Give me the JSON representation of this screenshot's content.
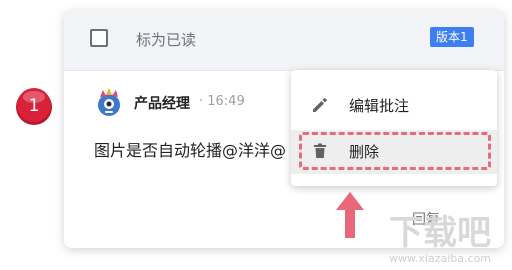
{
  "header": {
    "mark_read_label": "标为已读",
    "version_badge": "版本1"
  },
  "comment": {
    "author": "产品经理",
    "time": "· 16:49",
    "text": "图片是否自动轮播@洋洋@",
    "reply_label": "回复"
  },
  "menu": {
    "items": [
      {
        "label": "编辑批注",
        "icon": "pencil-icon"
      },
      {
        "label": "删除",
        "icon": "trash-icon"
      }
    ]
  },
  "annotation": {
    "step_number": "1",
    "highlight_color": "#e86b7b",
    "badge_color": "#d9223a"
  },
  "watermark": {
    "text": "下载吧",
    "url": "www.xiazaiba.com"
  },
  "colors": {
    "accent": "#3d7ff0",
    "header_bg": "#f2f3f6",
    "menu_hover_bg": "#eeeeef"
  }
}
